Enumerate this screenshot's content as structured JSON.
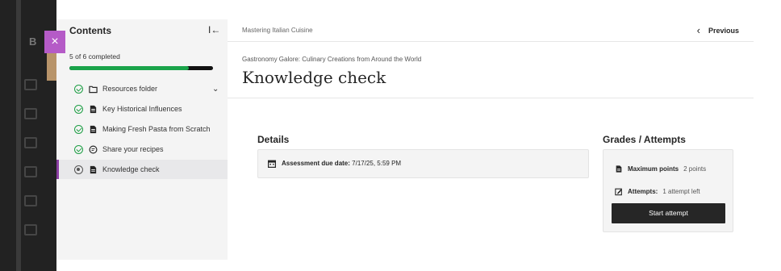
{
  "rail": {
    "letter": "B"
  },
  "close_glyph": "×",
  "sidebar": {
    "title": "Contents",
    "collapse_glyph": "I←",
    "progress_label": "5 of 6 completed",
    "progress_fraction": 0.83,
    "items": [
      {
        "label": "Resources folder",
        "type_icon": "folder-icon",
        "status": "done",
        "has_chevron": true,
        "chevron": "⌄"
      },
      {
        "label": "Key Historical Influences",
        "type_icon": "document-icon",
        "status": "done"
      },
      {
        "label": "Making Fresh Pasta from Scratch",
        "type_icon": "document-icon",
        "status": "done"
      },
      {
        "label": "Share your recipes",
        "type_icon": "discussion-icon",
        "status": "done"
      },
      {
        "label": "Knowledge check",
        "type_icon": "document-icon",
        "status": "pending",
        "active": true
      }
    ]
  },
  "topbar": {
    "course_name": "Mastering Italian Cuisine",
    "prev_glyph": "‹",
    "prev_label": "Previous"
  },
  "header": {
    "subtitle": "Gastronomy Galore: Culinary Creations from Around the World",
    "title": "Knowledge check"
  },
  "details": {
    "title": "Details",
    "due_label": "Assessment due date:",
    "due_value": "7/17/25, 5:59 PM"
  },
  "grades": {
    "title": "Grades / Attempts",
    "max_points_label": "Maximum points",
    "max_points_value": "2 points",
    "attempts_label": "Attempts:",
    "attempts_value": "1 attempt left",
    "start_button": "Start attempt"
  },
  "colors": {
    "accent": "#8b3fa3",
    "close_bg": "#b55bc7",
    "progress": "#1aa34a",
    "done": "#1e9e45",
    "button": "#262626"
  }
}
